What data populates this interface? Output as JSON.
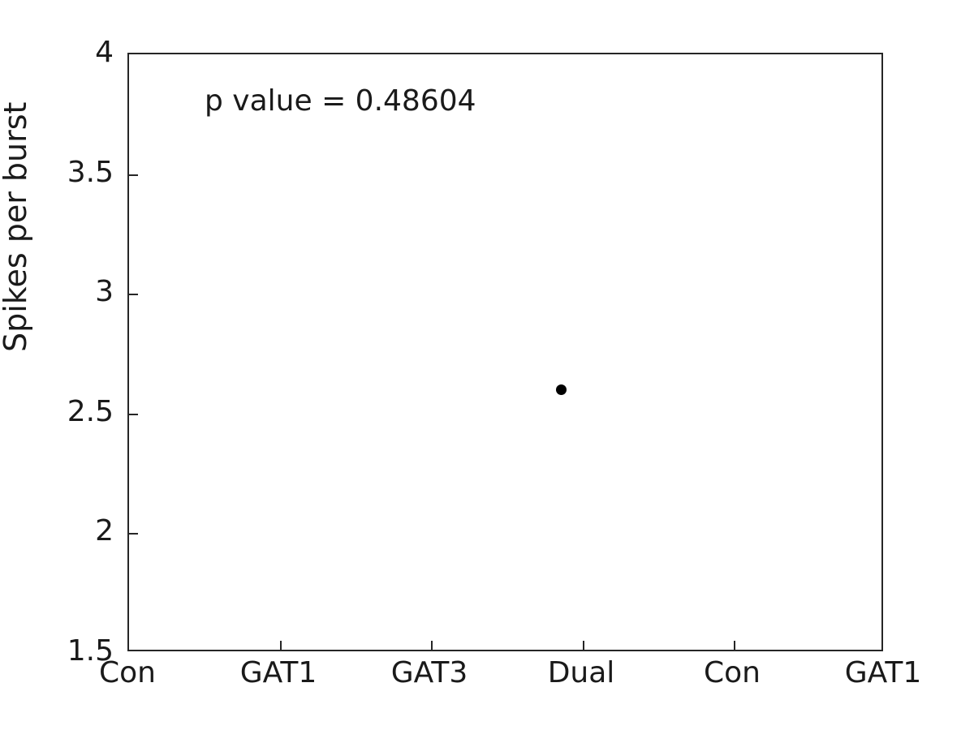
{
  "chart_data": {
    "type": "scatter",
    "title": "",
    "xlabel": "",
    "ylabel": "Spikes per burst",
    "ylim": [
      1.5,
      4
    ],
    "yticks": [
      "1.5",
      "2",
      "2.5",
      "3",
      "3.5",
      "4"
    ],
    "ytick_values": [
      1.5,
      2,
      2.5,
      3,
      3.5,
      4
    ],
    "categories": [
      "Con",
      "GAT1",
      "GAT3",
      "Dual",
      "Con",
      "GAT1"
    ],
    "category_positions": [
      1,
      2,
      3,
      4,
      5,
      6
    ],
    "xlim": [
      1,
      6
    ],
    "grid": false,
    "legend": null,
    "annotations": [
      {
        "name": "p-value",
        "text": "p value = 0.48604"
      }
    ],
    "marker_color": "#000000",
    "marker_style": "filled-circle",
    "points": [
      {
        "category": "Dual",
        "x": 3.86,
        "y": 2.6
      }
    ]
  },
  "axis": {
    "line_color": "#262626",
    "background": "#ffffff"
  }
}
